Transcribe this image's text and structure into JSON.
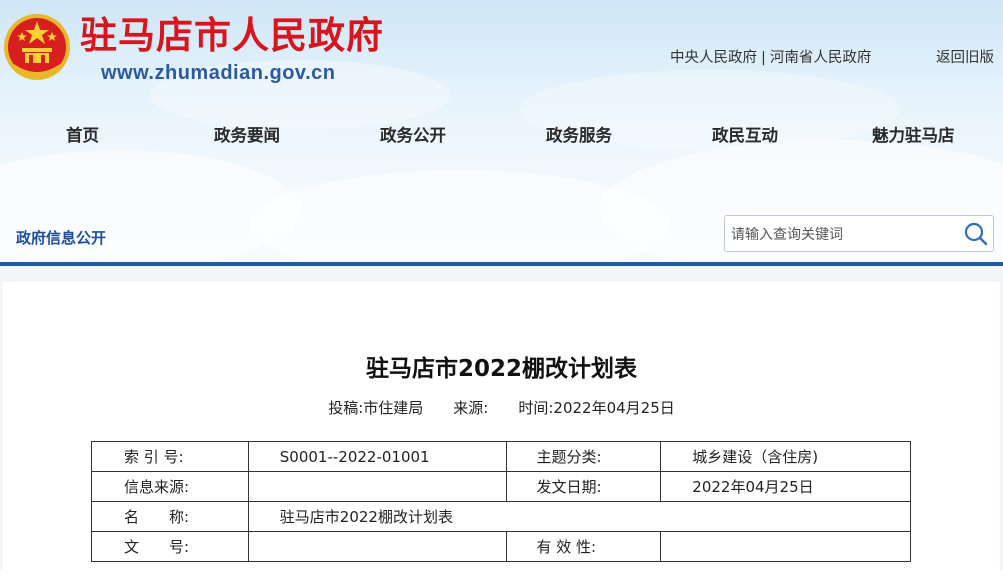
{
  "header": {
    "site_title": "驻马店市人民政府",
    "site_url": "www.zhumadian.gov.cn",
    "links": [
      "中央人民政府",
      "河南省人民政府"
    ],
    "link_separator": "|",
    "old_version": "返回旧版"
  },
  "nav": [
    "首页",
    "政务要闻",
    "政务公开",
    "政务服务",
    "政民互动",
    "魅力驻马店"
  ],
  "section": {
    "label": "政府信息公开"
  },
  "search": {
    "placeholder": "请输入查询关键词"
  },
  "article": {
    "title": "驻马店市2022棚改计划表",
    "meta": {
      "author_label": "投稿:",
      "author": "市住建局",
      "source_label": "来源:",
      "source": "",
      "date_label": "时间:",
      "date": "2022年04月25日"
    },
    "info_table": [
      [
        "索 引 号:",
        "S0001--2022-01001",
        "主题分类:",
        "城乡建设（含住房)"
      ],
      [
        "信息来源:",
        "",
        "发文日期:",
        "2022年04月25日"
      ],
      [
        "名　　称:",
        "驻马店市2022棚改计划表"
      ],
      [
        "文　　号:",
        "",
        "有 效 性:",
        ""
      ]
    ]
  },
  "colors": {
    "title_red": "#d8141d",
    "brand_blue": "#1b5cab",
    "section_blue": "#1c4f9c"
  }
}
